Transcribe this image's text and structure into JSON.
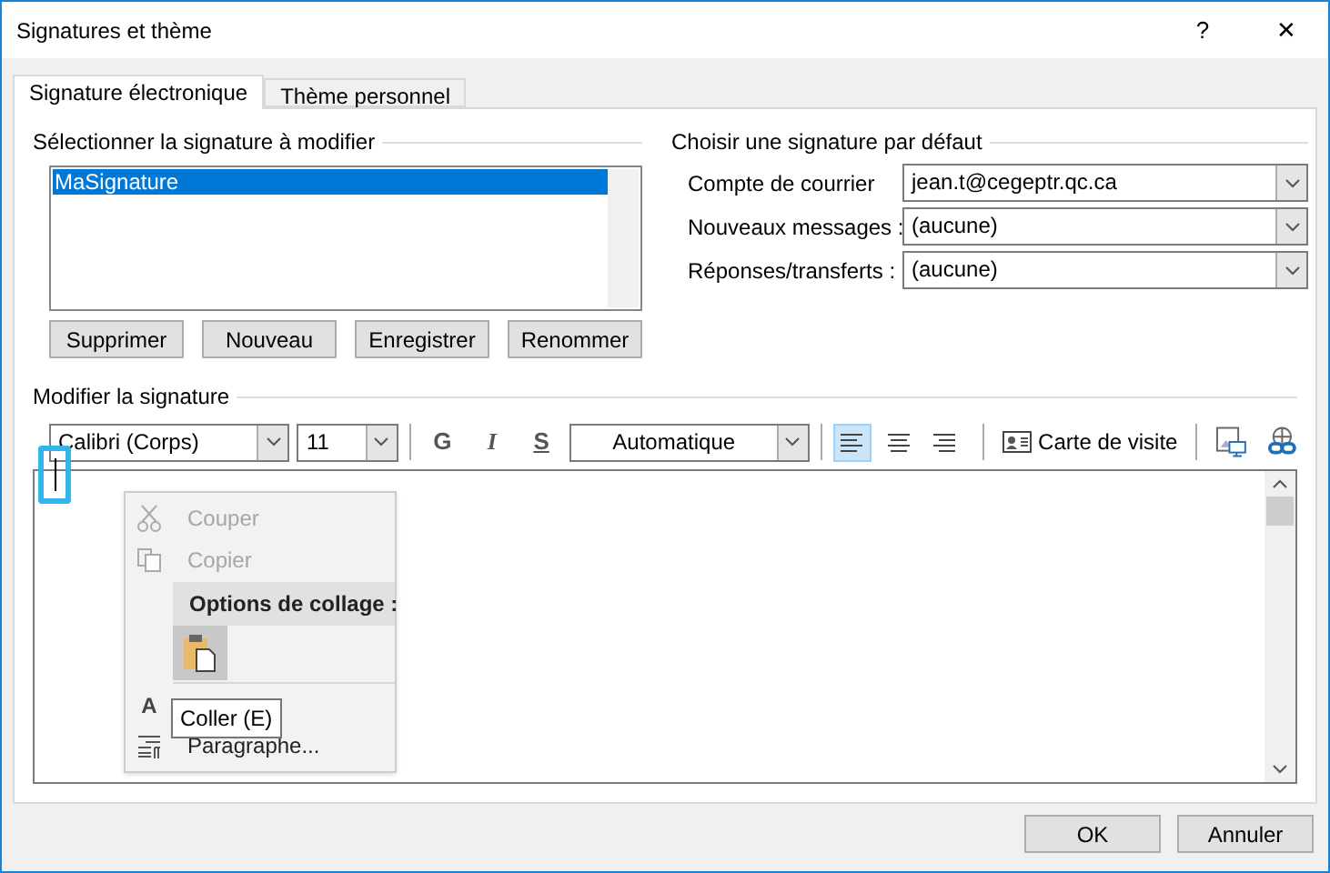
{
  "window": {
    "title": "Signatures et thème",
    "help": "?",
    "close": "✕"
  },
  "tabs": [
    {
      "label": "Signature électronique",
      "selected": true
    },
    {
      "label": "Thème personnel",
      "selected": false
    }
  ],
  "select_section": {
    "title": "Sélectionner la signature à modifier",
    "items": [
      {
        "label": "MaSignature",
        "selected": true
      }
    ],
    "buttons": [
      "Supprimer",
      "Nouveau",
      "Enregistrer",
      "Renommer"
    ]
  },
  "default_section": {
    "title": "Choisir une signature par défaut",
    "fields": [
      {
        "label": "Compte de courrier",
        "value": "jean.t@cegeptr.qc.ca"
      },
      {
        "label": "Nouveaux messages :",
        "value": "(aucune)"
      },
      {
        "label": "Réponses/transferts :",
        "value": "(aucune)"
      }
    ]
  },
  "edit_section": {
    "title": "Modifier la signature",
    "font": "Calibri (Corps)",
    "size": "11",
    "format_buttons": [
      "G",
      "I",
      "S"
    ],
    "font_color_label": "Automatique",
    "align": [
      {
        "kind": "left",
        "selected": true
      },
      {
        "kind": "center",
        "selected": false
      },
      {
        "kind": "right",
        "selected": false
      }
    ],
    "business_card": "Carte de visite"
  },
  "context_menu": {
    "items": [
      {
        "kind": "cut",
        "label": "Couper",
        "disabled": true
      },
      {
        "kind": "copy",
        "label": "Copier",
        "disabled": true
      },
      {
        "kind": "paste_header",
        "label": "Options de collage :",
        "disabled": false
      },
      {
        "kind": "paste_options"
      },
      {
        "kind": "font",
        "icon_text": "A",
        "disabled": false
      },
      {
        "kind": "paragraph",
        "label": "Paragraphe...",
        "disabled": false
      }
    ]
  },
  "tooltip": "Coller (E)",
  "footer_buttons": [
    "OK",
    "Annuler"
  ]
}
